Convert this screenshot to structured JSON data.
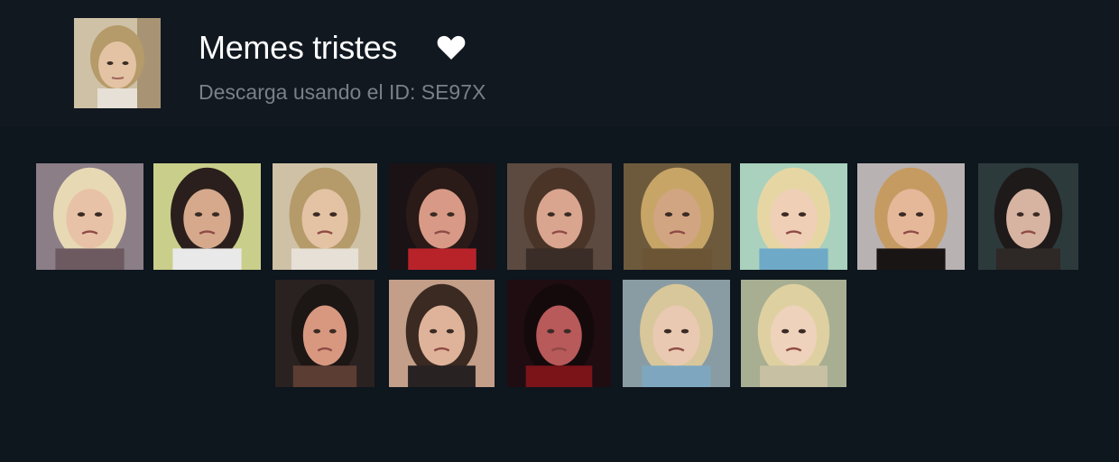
{
  "pack": {
    "title": "Memes tristes",
    "subtitle": "Descarga usando el ID: SE97X",
    "favorite_icon": "heart-icon",
    "cover_icon": "sticker-thumbnail"
  },
  "stickers": [
    {
      "name": "sticker-1",
      "bg": "#8b7e86",
      "hair": "#e7d9b4",
      "skin": "#e8c2a6",
      "shirt": "#6c5a60"
    },
    {
      "name": "sticker-2",
      "bg": "#c9cf8a",
      "hair": "#2a1f1c",
      "skin": "#d6a98c",
      "shirt": "#e9e9ea"
    },
    {
      "name": "sticker-3",
      "bg": "#cfc1a6",
      "hair": "#b59a6a",
      "skin": "#e3c3a3",
      "shirt": "#e6e0d6"
    },
    {
      "name": "sticker-4",
      "bg": "#1a1214",
      "hair": "#2a1a18",
      "skin": "#d89a86",
      "shirt": "#b8232a"
    },
    {
      "name": "sticker-5",
      "bg": "#5c4a40",
      "hair": "#4a3428",
      "skin": "#d9a58e",
      "shirt": "#3a2d27"
    },
    {
      "name": "sticker-6",
      "bg": "#6d5a3c",
      "hair": "#c7a567",
      "skin": "#d2a582",
      "shirt": "#6b5535"
    },
    {
      "name": "sticker-7",
      "bg": "#a9d1bd",
      "hair": "#e6d6a4",
      "skin": "#efcfb6",
      "shirt": "#6ea9c7"
    },
    {
      "name": "sticker-8",
      "bg": "#b9b2b3",
      "hair": "#c69b62",
      "skin": "#e5b89a",
      "shirt": "#1a1515"
    },
    {
      "name": "sticker-9",
      "bg": "#2d3a3c",
      "hair": "#1e1a19",
      "skin": "#d7b3a2",
      "shirt": "#2e2826"
    },
    {
      "name": "sticker-10",
      "bg": "#2a2220",
      "hair": "#1c1614",
      "skin": "#d89880",
      "shirt": "#5b3d33"
    },
    {
      "name": "sticker-11",
      "bg": "#c39e88",
      "hair": "#3a2a22",
      "skin": "#dfb39a",
      "shirt": "#282223"
    },
    {
      "name": "sticker-12",
      "bg": "#1f0d12",
      "hair": "#140a0c",
      "skin": "#b8595a",
      "shirt": "#7a1418"
    },
    {
      "name": "sticker-13",
      "bg": "#8a9ca3",
      "hair": "#d8c79a",
      "skin": "#e9c9b2",
      "shirt": "#7ea7bf"
    },
    {
      "name": "sticker-14",
      "bg": "#a8ae92",
      "hair": "#ded0a0",
      "skin": "#eed2bb",
      "shirt": "#c7c0a2"
    }
  ]
}
